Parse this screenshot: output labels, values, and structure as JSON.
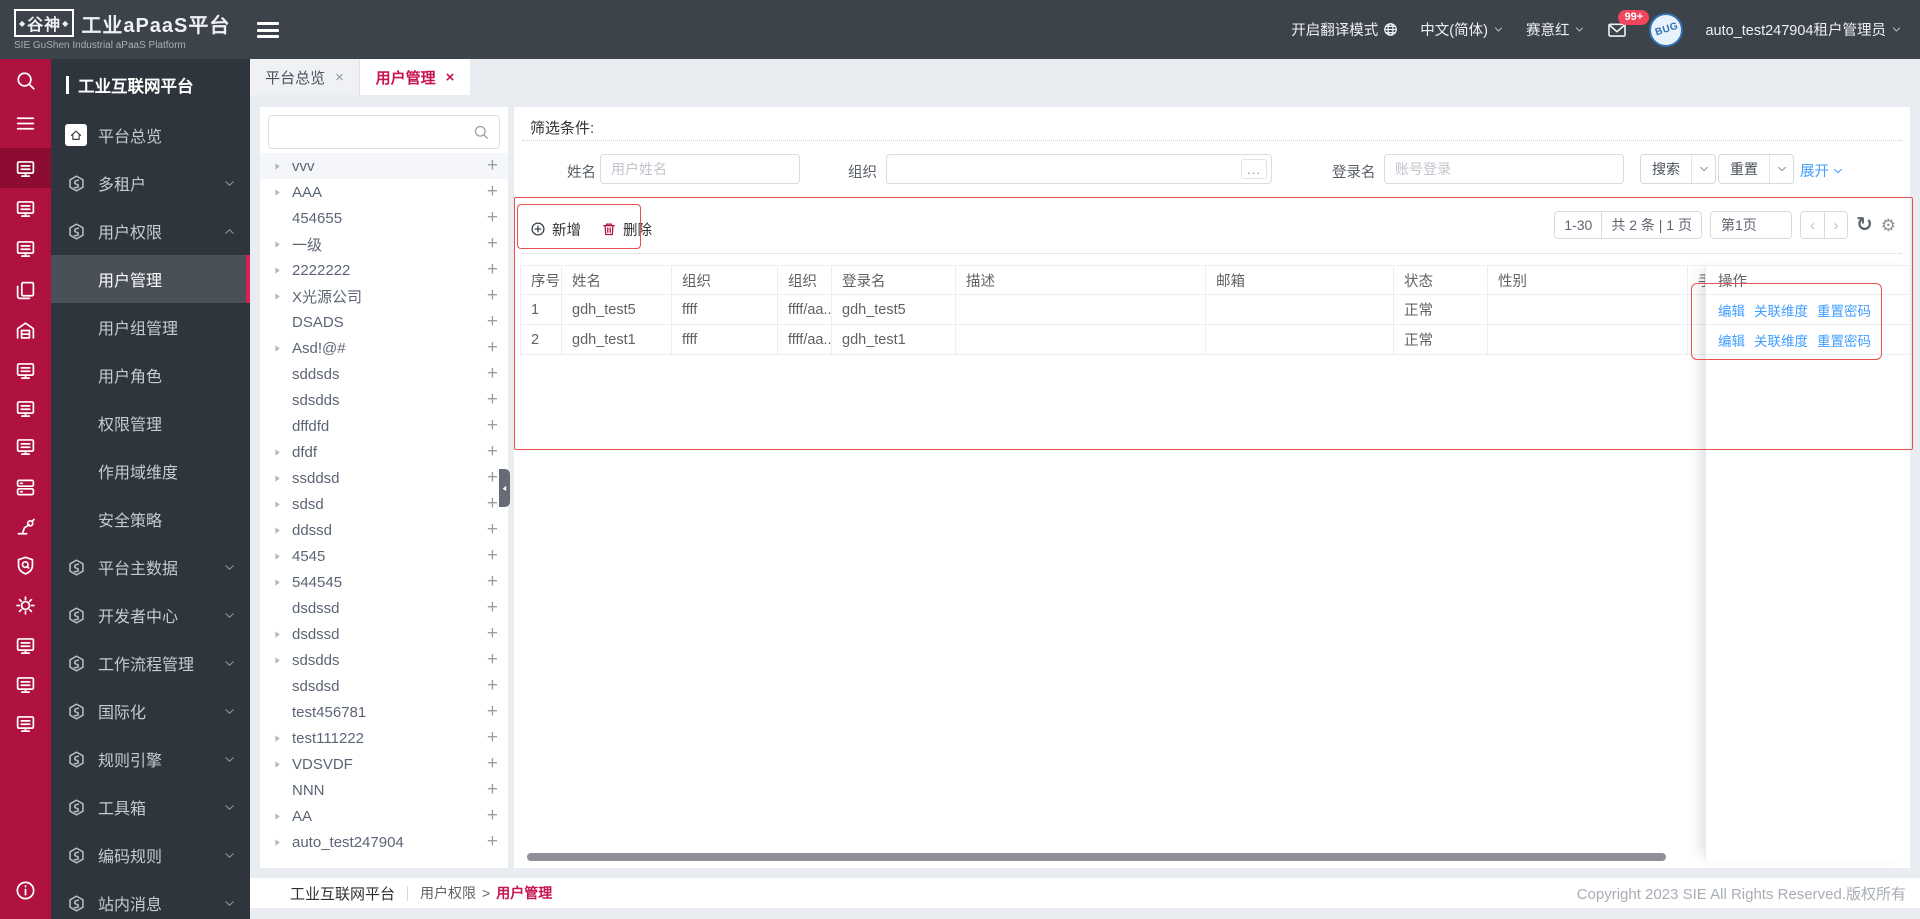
{
  "colors": {
    "accent_crimson": "#b01240",
    "selected_rail": "#8d0c31",
    "link_blue": "#409eff",
    "active_tab_red": "#c7164e",
    "annotation_red": "#e85050",
    "header_dark": "#3d434b",
    "sidebar_dark": "#2f353c"
  },
  "header": {
    "logo_mark": "谷神",
    "logo_title": "工业aPaaS平台",
    "logo_subtitle": "SIE GuShen Industrial aPaaS Platform",
    "translate_label": "开启翻译模式",
    "language": "中文(简体)",
    "theme_name": "赛意红",
    "mail_badge": "99+",
    "avatar_text": "BUG",
    "user_name": "auto_test247904租户管理员"
  },
  "rail": {
    "icons": [
      "search",
      "menu",
      "display",
      "display",
      "display",
      "copy",
      "warehouse",
      "display",
      "display",
      "display",
      "server",
      "robot-arm",
      "shield",
      "gear",
      "display",
      "display",
      "display",
      "info"
    ],
    "selected_index": 2
  },
  "sidebar": {
    "section_title": "工业互联网平台",
    "items": [
      {
        "label": "平台总览",
        "home": true
      },
      {
        "label": "多租户",
        "chevron": "down"
      },
      {
        "label": "用户权限",
        "chevron": "up",
        "children": [
          {
            "label": "用户管理",
            "selected": true
          },
          {
            "label": "用户组管理"
          },
          {
            "label": "用户角色"
          },
          {
            "label": "权限管理"
          },
          {
            "label": "作用域维度"
          },
          {
            "label": "安全策略"
          }
        ]
      },
      {
        "label": "平台主数据",
        "chevron": "down"
      },
      {
        "label": "开发者中心",
        "chevron": "down"
      },
      {
        "label": "工作流程管理",
        "chevron": "down"
      },
      {
        "label": "国际化",
        "chevron": "down"
      },
      {
        "label": "规则引擎",
        "chevron": "down"
      },
      {
        "label": "工具箱",
        "chevron": "down"
      },
      {
        "label": "编码规则",
        "chevron": "down"
      },
      {
        "label": "站内消息",
        "chevron": "down"
      }
    ]
  },
  "tabs": [
    {
      "label": "平台总览",
      "active": false
    },
    {
      "label": "用户管理",
      "active": true
    }
  ],
  "tree": {
    "search_placeholder": "",
    "items": [
      {
        "label": "vvv",
        "caret": true,
        "selected": true
      },
      {
        "label": "AAA",
        "caret": true
      },
      {
        "label": "454655",
        "caret": false
      },
      {
        "label": "一级",
        "caret": true
      },
      {
        "label": "2222222",
        "caret": true
      },
      {
        "label": "X光源公司",
        "caret": true
      },
      {
        "label": "DSADS",
        "caret": false
      },
      {
        "label": "Asd!@#",
        "caret": true
      },
      {
        "label": "sddsds",
        "caret": false
      },
      {
        "label": "sdsdds",
        "caret": false
      },
      {
        "label": "dffdfd",
        "caret": false
      },
      {
        "label": "dfdf",
        "caret": true
      },
      {
        "label": "ssddsd",
        "caret": true
      },
      {
        "label": "sdsd",
        "caret": true
      },
      {
        "label": "ddssd",
        "caret": true
      },
      {
        "label": "4545",
        "caret": true
      },
      {
        "label": "544545",
        "caret": true
      },
      {
        "label": "dsdssd",
        "caret": false
      },
      {
        "label": "dsdssd",
        "caret": true
      },
      {
        "label": "sdsdds",
        "caret": true
      },
      {
        "label": "sdsdsd",
        "caret": false
      },
      {
        "label": "test456781",
        "caret": false
      },
      {
        "label": "test111222",
        "caret": true
      },
      {
        "label": "VDSVDF",
        "caret": true
      },
      {
        "label": "NNN",
        "caret": false
      },
      {
        "label": "AA",
        "caret": true
      },
      {
        "label": "auto_test247904",
        "caret": true
      }
    ]
  },
  "filters": {
    "title": "筛选条件:",
    "name_label": "姓名",
    "name_placeholder": "用户姓名",
    "org_label": "组织",
    "org_dots": "...",
    "login_label": "登录名",
    "login_placeholder": "账号登录",
    "search_button": "搜索",
    "reset_button": "重置",
    "expand_link": "展开"
  },
  "toolbar": {
    "add_label": "新增",
    "delete_label": "删除"
  },
  "pagination": {
    "range": "1-30",
    "total": "共 2 条 | 1 页",
    "page_input": "第1页"
  },
  "table": {
    "columns": [
      "序号",
      "姓名",
      "组织",
      "组织",
      "登录名",
      "描述",
      "邮箱",
      "状态",
      "性别",
      "手"
    ],
    "ops_column": "操作",
    "rows": [
      {
        "cells": [
          "1",
          "gdh_test5",
          "ffff",
          "ffff/aa...",
          "gdh_test5",
          "",
          "",
          "正常",
          "",
          ""
        ],
        "ops": [
          "编辑",
          "关联维度",
          "重置密码"
        ]
      },
      {
        "cells": [
          "2",
          "gdh_test1",
          "ffff",
          "ffff/aa...",
          "gdh_test1",
          "",
          "",
          "正常",
          "",
          ""
        ],
        "ops": [
          "编辑",
          "关联维度",
          "重置密码"
        ]
      }
    ]
  },
  "footer": {
    "platform": "工业互联网平台",
    "breadcrumb_parent": "用户权限",
    "breadcrumb_sep": ">",
    "breadcrumb_current": "用户管理",
    "copyright": "Copyright 2023 SIE All Rights Reserved.版权所有"
  }
}
